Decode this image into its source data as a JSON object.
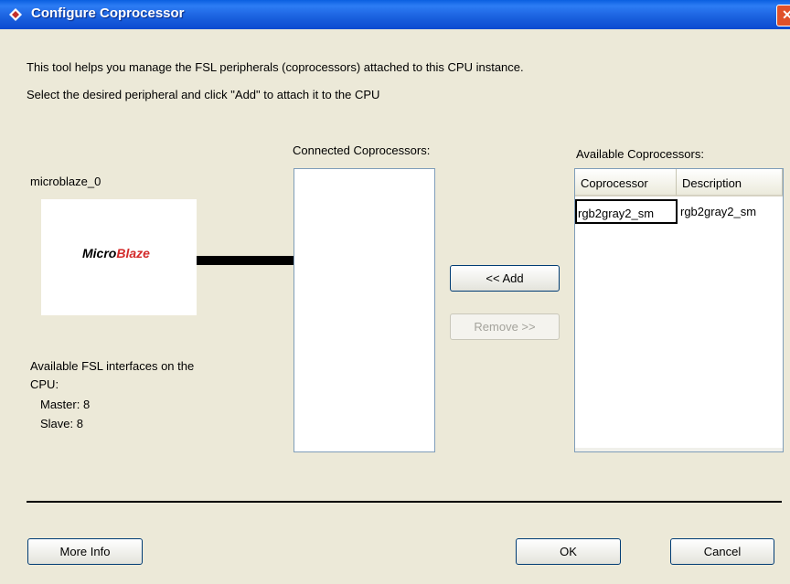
{
  "window": {
    "title": "Configure Coprocessor",
    "close_glyph": "✕"
  },
  "intro": {
    "line1": "This tool helps you manage the FSL peripherals (coprocessors) attached to this CPU instance.",
    "line2": "Select the desired peripheral and click \"Add\" to attach it to the CPU"
  },
  "cpu": {
    "name": "microblaze_0",
    "logo_part1": "Micro",
    "logo_part2": "Blaze",
    "interfaces_label_line1": "Available FSL interfaces on the",
    "interfaces_label_line2": "CPU:",
    "master": "Master: 8",
    "slave": "Slave: 8"
  },
  "connected": {
    "label": "Connected Coprocessors:",
    "items": []
  },
  "buttons": {
    "add": "<< Add",
    "remove": "Remove >>",
    "more_info": "More Info",
    "ok": "OK",
    "cancel": "Cancel"
  },
  "available": {
    "label": "Available Coprocessors:",
    "columns": [
      "Coprocessor",
      "Description"
    ],
    "rows": [
      {
        "coprocessor": "rgb2gray2_sm",
        "description": "rgb2gray2_sm"
      }
    ]
  },
  "colors": {
    "title_bar": "#0a5fe0",
    "window_bg": "#ece9d8",
    "logo_red": "#d32a2a"
  }
}
